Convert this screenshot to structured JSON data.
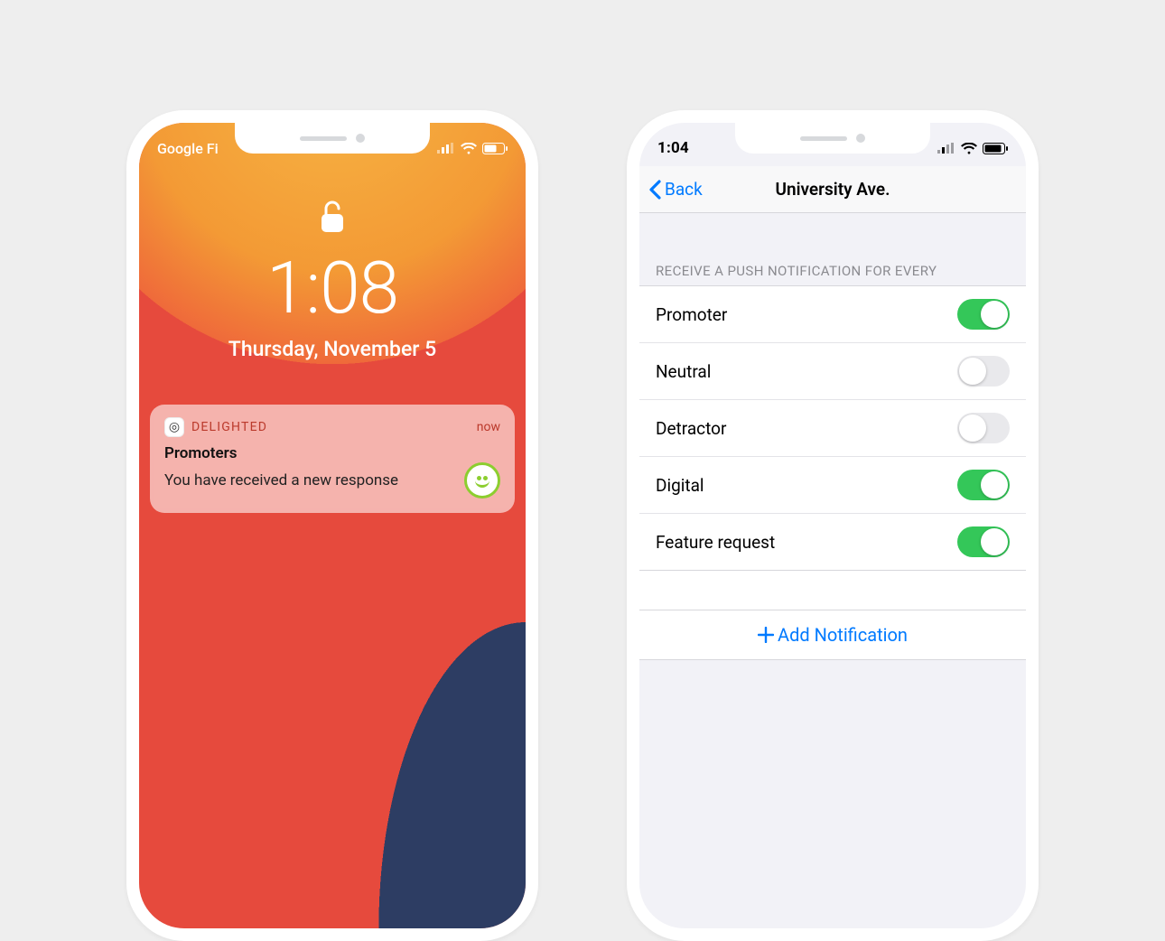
{
  "left": {
    "carrier": "Google Fi",
    "time": "1:08",
    "date": "Thursday, November 5",
    "notification": {
      "app": "DELIGHTED",
      "when": "now",
      "title": "Promoters",
      "body": "You have received a new response"
    }
  },
  "right": {
    "time": "1:04",
    "back_label": "Back",
    "title": "University Ave.",
    "section_header": "RECEIVE A PUSH NOTIFICATION FOR EVERY",
    "rows": [
      {
        "label": "Promoter",
        "on": true
      },
      {
        "label": "Neutral",
        "on": false
      },
      {
        "label": "Detractor",
        "on": false
      },
      {
        "label": "Digital",
        "on": true
      },
      {
        "label": "Feature request",
        "on": true
      }
    ],
    "add_label": "Add Notification"
  }
}
